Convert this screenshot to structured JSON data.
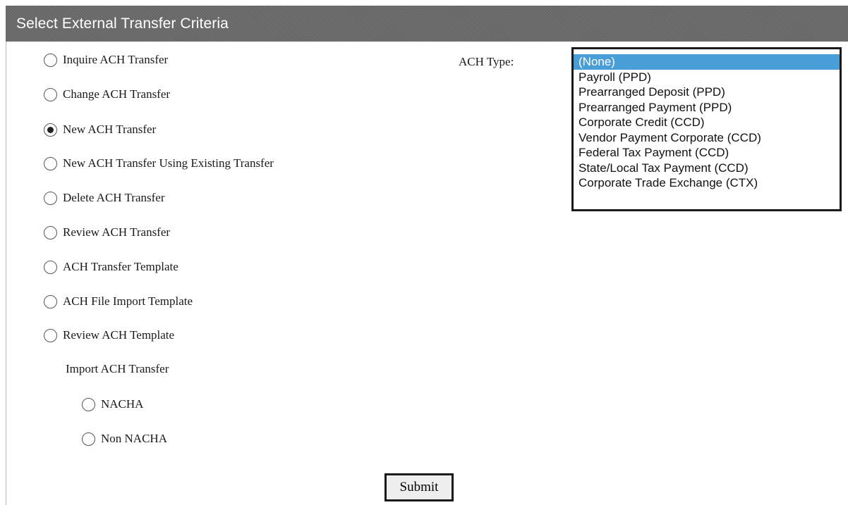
{
  "header": {
    "title": "Select External Transfer Criteria"
  },
  "options": [
    {
      "label": "Inquire ACH Transfer",
      "checked": false
    },
    {
      "label": "Change ACH Transfer",
      "checked": false
    },
    {
      "label": "New ACH Transfer",
      "checked": true
    },
    {
      "label": "New ACH Transfer Using Existing Transfer",
      "checked": false
    },
    {
      "label": "Delete ACH Transfer",
      "checked": false
    },
    {
      "label": "Review ACH Transfer",
      "checked": false
    },
    {
      "label": "ACH Transfer Template",
      "checked": false
    },
    {
      "label": "ACH File Import Template",
      "checked": false
    },
    {
      "label": "Review ACH Template",
      "checked": false
    }
  ],
  "import": {
    "label": "Import ACH Transfer",
    "options": [
      {
        "label": "NACHA",
        "checked": false
      },
      {
        "label": "Non NACHA",
        "checked": false
      }
    ]
  },
  "ach_type": {
    "label": "ACH Type:",
    "selected": "(None)",
    "options": [
      "(None)",
      "Payroll (PPD)",
      "Prearranged Deposit (PPD)",
      "Prearranged Payment (PPD)",
      "Corporate Credit (CCD)",
      "Vendor Payment Corporate (CCD)",
      "Federal Tax Payment (CCD)",
      "State/Local Tax Payment (CCD)",
      "Corporate Trade Exchange (CTX)"
    ]
  },
  "submit_label": "Submit",
  "colors": {
    "header_bg": "#6a6a6a",
    "selection": "#4a9ed8"
  }
}
